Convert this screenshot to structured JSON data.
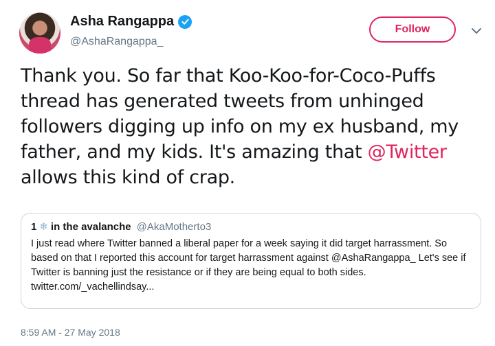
{
  "author": {
    "display_name": "Asha Rangappa",
    "handle": "@AshaRangappa_"
  },
  "follow_button": {
    "label": "Follow"
  },
  "tweet": {
    "text_before": "Thank you. So far that Koo-Koo-for-Coco-Puffs thread has generated tweets from unhinged followers digging up info on my ex husband, my father, and my kids. It's amazing that ",
    "mention": "@Twitter",
    "text_after": " allows this kind of crap."
  },
  "quoted_tweet": {
    "name_prefix": "1",
    "name": "in the avalanche",
    "handle": "@AkaMotherto3",
    "text": "I just read where Twitter banned a liberal paper for a week saying it did target harrassment. So based on that I reported this account for target harrassment against @AshaRangappa_  Let's see if Twitter is banning just the resistance or if they are being equal to both sides. twitter.com/_vachellindsay..."
  },
  "timestamp": "8:59 AM - 27 May 2018",
  "icons": {
    "verified": "verified-badge-icon",
    "chevron": "chevron-down-icon",
    "snowflake": "snowflake-icon"
  },
  "colors": {
    "accent": "#e0245e",
    "verified": "#1da1f2",
    "secondary_text": "#657786"
  }
}
